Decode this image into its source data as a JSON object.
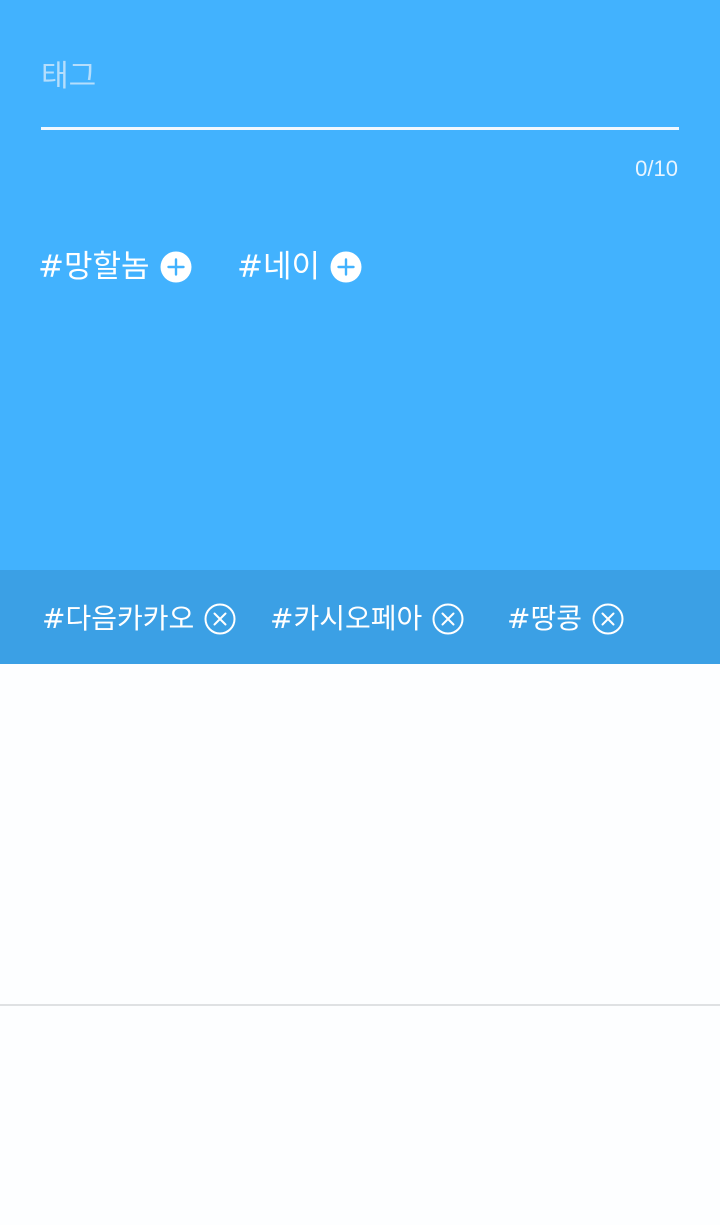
{
  "tag_input": {
    "placeholder": "태그",
    "value": ""
  },
  "char_counter": "0/10",
  "suggestions": [
    {
      "label": "#망할놈",
      "icon": "plus-circle-icon"
    },
    {
      "label": "#네이",
      "icon": "plus-circle-icon"
    }
  ],
  "selected_tags": [
    {
      "label": "#다음카카오",
      "icon": "remove-circle-icon"
    },
    {
      "label": "#카시오페아",
      "icon": "remove-circle-icon"
    },
    {
      "label": "#땅콩",
      "icon": "remove-circle-icon"
    }
  ],
  "colors": {
    "panel_background": "#42b2fe",
    "selected_bar_background": "#3ba0e5",
    "placeholder": "#b5defc",
    "text": "#ffffff",
    "page_background": "#fdfeff",
    "divider": "#dfe1e3"
  }
}
